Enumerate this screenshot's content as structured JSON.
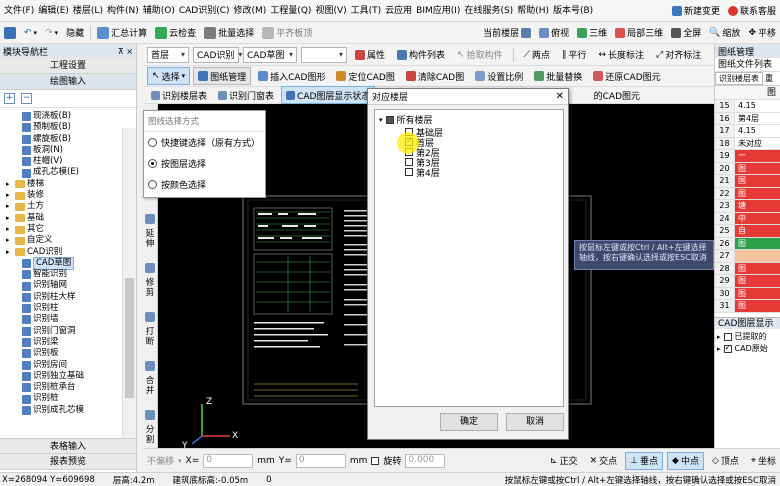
{
  "menu": {
    "items": [
      "文件(F)",
      "编辑(E)",
      "楼层(L)",
      "构件(N)",
      "辅助(O)",
      "CAD识别(C)",
      "修改(M)",
      "工程量(Q)",
      "视图(V)",
      "工具(T)",
      "云应用",
      "BIM应用(I)",
      "在线服务(S)",
      "帮助(H)",
      "版本号(B)"
    ],
    "new_change": "新建变更",
    "contact": "联系客服"
  },
  "toolbar1": {
    "hide": "隐藏",
    "summary_calc": "汇总计算",
    "cloud_check": "云检查",
    "batch_select": "批量选择",
    "flat_board": "平齐板顶",
    "current_floor": "当前楼层",
    "view_mode": "俯视",
    "three_d": "三维",
    "local_3d": "局部三维",
    "fullscreen": "全屏",
    "zoom": "缩放",
    "pan": "平移"
  },
  "toolbar2": {
    "floor": "首层",
    "cad_recognize": "CAD识别",
    "cad_sketch": "CAD草图",
    "properties": "属性",
    "component_list": "构件列表",
    "pick_component": "拾取构件",
    "two_points": "两点",
    "parallel": "平行",
    "length_mark": "长度标注",
    "align_mark": "对齐标注"
  },
  "toolbar3": {
    "select": "选择",
    "drawing_manage": "图纸管理",
    "insert_cad": "插入CAD图形",
    "locate_cad": "定位CAD图",
    "clear_cad": "清除CAD图",
    "set_scale": "设置比例",
    "batch_replace": "批量替换",
    "restore_cad": "还原CAD图元"
  },
  "toolbar4": {
    "recognize_floor_table": "识别楼层表",
    "recognize_door_table": "识别门窗表",
    "cad_display": "CAD图层显示状态",
    "cad_element": "的CAD图元"
  },
  "left_panel": {
    "title": "模块导航栏",
    "project_settings": "工程设置",
    "drawing_input": "绘图输入",
    "table_input": "表格输入",
    "report_preview": "报表预览",
    "tree": [
      {
        "label": "现浇板(B)",
        "kind": "leaf",
        "indent": 2
      },
      {
        "label": "预制板(B)",
        "kind": "leaf",
        "indent": 2
      },
      {
        "label": "螺旋板(B)",
        "kind": "leaf",
        "indent": 2
      },
      {
        "label": "板洞(N)",
        "kind": "leaf",
        "indent": 2
      },
      {
        "label": "柱帽(V)",
        "kind": "leaf",
        "indent": 2
      },
      {
        "label": "成孔芯模(E)",
        "kind": "leaf",
        "indent": 2
      },
      {
        "label": "楼梯",
        "kind": "folder",
        "indent": 1
      },
      {
        "label": "装修",
        "kind": "folder",
        "indent": 1
      },
      {
        "label": "土方",
        "kind": "folder",
        "indent": 1
      },
      {
        "label": "基础",
        "kind": "folder",
        "indent": 1
      },
      {
        "label": "其它",
        "kind": "folder",
        "indent": 1
      },
      {
        "label": "自定义",
        "kind": "folder",
        "indent": 1
      },
      {
        "label": "CAD识别",
        "kind": "folder",
        "indent": 1
      },
      {
        "label": "CAD草图",
        "kind": "leaf",
        "indent": 2,
        "selected": true
      },
      {
        "label": "智能识别",
        "kind": "leaf",
        "indent": 2
      },
      {
        "label": "识别轴网",
        "kind": "leaf",
        "indent": 2
      },
      {
        "label": "识别柱大样",
        "kind": "leaf",
        "indent": 2
      },
      {
        "label": "识别柱",
        "kind": "leaf",
        "indent": 2
      },
      {
        "label": "识别墙",
        "kind": "leaf",
        "indent": 2
      },
      {
        "label": "识别门窗洞",
        "kind": "leaf",
        "indent": 2
      },
      {
        "label": "识别梁",
        "kind": "leaf",
        "indent": 2
      },
      {
        "label": "识别板",
        "kind": "leaf",
        "indent": 2
      },
      {
        "label": "识别房间",
        "kind": "leaf",
        "indent": 2
      },
      {
        "label": "识别独立基础",
        "kind": "leaf",
        "indent": 2
      },
      {
        "label": "识别桩承台",
        "kind": "leaf",
        "indent": 2
      },
      {
        "label": "识别桩",
        "kind": "leaf",
        "indent": 2
      },
      {
        "label": "识别成孔芯模",
        "kind": "leaf",
        "indent": 2
      }
    ]
  },
  "layer_popup": {
    "title": "图线选择方式",
    "options": [
      {
        "label": "快捷键选择（原有方式）",
        "checked": false
      },
      {
        "label": "按图层选择",
        "checked": true
      },
      {
        "label": "按颜色选择",
        "checked": false
      }
    ]
  },
  "vertical_tools": [
    "延伸",
    "修剪",
    "打断",
    "合并",
    "分割"
  ],
  "dialog": {
    "title": "对应楼层",
    "root": "所有楼层",
    "floors": [
      {
        "label": "基础层",
        "checked": false
      },
      {
        "label": "首层",
        "checked": true
      },
      {
        "label": "第2层",
        "checked": false
      },
      {
        "label": "第3层",
        "checked": false
      },
      {
        "label": "第4层",
        "checked": false
      }
    ],
    "ok": "确定",
    "cancel": "取消"
  },
  "tooltip": "按鼠标左键或按Ctrl / Alt+左键选择轴线，按右键确认选择或按ESC取消",
  "right_panel": {
    "title": "图纸管理",
    "file_list": "图纸文件列表",
    "tab_floor_table": "识别楼层表",
    "tab_more": "重",
    "header": "图",
    "rows": [
      {
        "n": "15",
        "text": "4.15",
        "color": "#ffffff"
      },
      {
        "n": "16",
        "text": "第4层",
        "color": "#ffffff"
      },
      {
        "n": "17",
        "text": "4.15",
        "color": "#ffffff"
      },
      {
        "n": "18",
        "text": "未对应",
        "color": "#ffffff"
      },
      {
        "n": "19",
        "text": "一",
        "color": "#e53935"
      },
      {
        "n": "20",
        "text": "图",
        "color": "#e53935"
      },
      {
        "n": "21",
        "text": "国",
        "color": "#e53935"
      },
      {
        "n": "22",
        "text": "图",
        "color": "#e53935"
      },
      {
        "n": "23",
        "text": "塘",
        "color": "#e53935"
      },
      {
        "n": "24",
        "text": "中",
        "color": "#e53935"
      },
      {
        "n": "25",
        "text": "自",
        "color": "#e53935"
      },
      {
        "n": "26",
        "text": "图",
        "color": "#2e9e4a"
      },
      {
        "n": "27",
        "text": "",
        "color": "#f4c3a0"
      },
      {
        "n": "28",
        "text": "图",
        "color": "#e53935"
      },
      {
        "n": "29",
        "text": "图",
        "color": "#e53935"
      },
      {
        "n": "30",
        "text": "图",
        "color": "#e53935"
      },
      {
        "n": "31",
        "text": "图",
        "color": "#e53935"
      }
    ],
    "layer_title": "CAD图层显示",
    "layer_items": [
      {
        "label": "已提取的",
        "checked": false
      },
      {
        "label": "CAD原始",
        "checked": true
      }
    ]
  },
  "bottom_tools": {
    "no_offset": "不偏移",
    "x_label": "X=",
    "x_value": "0",
    "mm1": "mm",
    "y_label": "Y=",
    "y_value": "0",
    "mm2": "mm",
    "rotate": "旋转",
    "rotate_value": "0.000",
    "ortho": "正交",
    "intersect": "交点",
    "perp": "垂点",
    "mid": "中点",
    "vertex": "顶点",
    "coord": "坐标"
  },
  "status": {
    "coords": "X=268094 Y=609698",
    "floor_height": "层高:4.2m",
    "base_elev": "建筑底标高:-0.05m",
    "zero": "0",
    "hint": "按鼠标左键或按Ctrl / Alt+左键选择轴线，按右键确认选择或按ESC取消"
  }
}
